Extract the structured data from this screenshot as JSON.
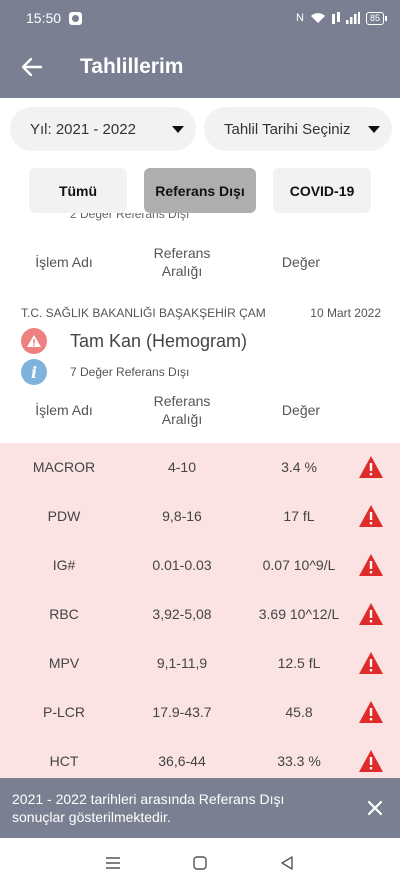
{
  "status_bar": {
    "time": "15:50",
    "battery": "85"
  },
  "app_bar": {
    "title": "Tahlillerim"
  },
  "filters": {
    "year": "Yıl: 2021 - 2022",
    "date": "Tahlil Tarihi Seçiniz"
  },
  "segments": {
    "all": "Tümü",
    "ref": "Referans Dışı",
    "covid": "COVID-19"
  },
  "prev_group": {
    "summary": "2 Değer Referans Dışı"
  },
  "columns": {
    "name": "İşlem Adı",
    "range": "Referans Aralığı",
    "value": "Değer"
  },
  "group": {
    "hospital": "T.C. SAĞLIK BAKANLIĞI BAŞAKŞEHİR ÇAM",
    "date": "10 Mart 2022",
    "test": "Tam Kan (Hemogram)",
    "summary": "7 Değer Referans Dışı"
  },
  "results": [
    {
      "name": "MACROR",
      "range": "4-10",
      "value": "3.4 %"
    },
    {
      "name": "PDW",
      "range": "9,8-16",
      "value": "17 fL"
    },
    {
      "name": "IG#",
      "range": "0.01-0.03",
      "value": "0.07 10^9/L"
    },
    {
      "name": "RBC",
      "range": "3,92-5,08",
      "value": "3.69 10^12/L"
    },
    {
      "name": "MPV",
      "range": "9,1-11,9",
      "value": "12.5 fL"
    },
    {
      "name": "P-LCR",
      "range": "17.9-43.7",
      "value": "45.8"
    },
    {
      "name": "HCT",
      "range": "36,6-44",
      "value": "33.3 %"
    }
  ],
  "snackbar": {
    "text": "2021 - 2022 tarihleri arasında Referans Dışı sonuçlar gösterilmektedir."
  },
  "icons": {
    "back": "arrow-left-icon",
    "caret": "chevron-down-icon",
    "warning": "warning-triangle-icon",
    "info": "info-icon",
    "close": "close-icon",
    "menu": "menu-icon",
    "home": "home-square-icon",
    "nav_back": "triangle-back-icon"
  },
  "colors": {
    "app_bar": "#7a8091",
    "warning": "#e02b2b",
    "result_bg": "#fbe3e3",
    "info": "#7eb3dc"
  }
}
